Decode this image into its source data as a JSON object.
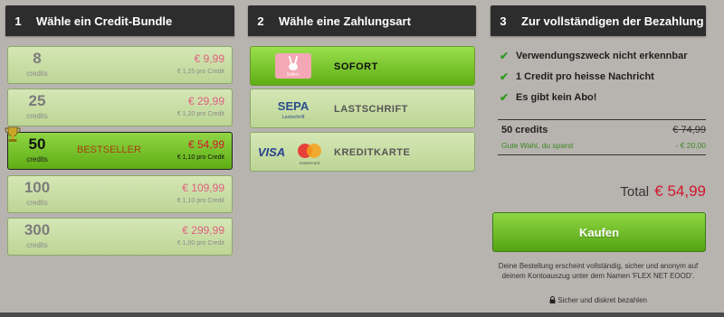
{
  "steps": [
    {
      "num": "1",
      "title": "Wähle ein Credit-Bundle"
    },
    {
      "num": "2",
      "title": "Wähle eine Zahlungsart"
    },
    {
      "num": "3",
      "title": "Zur vollständigen der Bezahlung"
    }
  ],
  "bundles": [
    {
      "credits": "8",
      "label": "credits",
      "price": "€ 9,99",
      "per": "€ 1,25 pro Credit"
    },
    {
      "credits": "25",
      "label": "credits",
      "price": "€ 29,99",
      "per": "€ 1,20 pro Credit"
    },
    {
      "credits": "50",
      "label": "credits",
      "price": "€ 54,99",
      "per": "€ 1,10 pro Credit",
      "badge": "BESTSELLER",
      "selected": true
    },
    {
      "credits": "100",
      "label": "credits",
      "price": "€ 109,99",
      "per": "€ 1,10 pro Credit"
    },
    {
      "credits": "300",
      "label": "credits",
      "price": "€ 299,99",
      "per": "€ 1,00 pro Credit"
    }
  ],
  "payments": [
    {
      "label": "SOFORT",
      "logo_text": "Sofort.",
      "icon": "sofort-logo-icon",
      "selected": true
    },
    {
      "label": "LASTSCHRIFT",
      "logo_text": "SEPA",
      "logo_sub": "Lastschrift",
      "icon": "sepa-logo-icon"
    },
    {
      "label": "KREDITKARTE",
      "logo_text": "VISA",
      "logo_sub": "mastercard",
      "icon": "visa-mastercard-logo-icon"
    }
  ],
  "benefits": [
    "Verwendungszweck nicht erkennbar",
    "1 Credit pro heisse Nachricht",
    "Es gibt kein Abo!"
  ],
  "summary": {
    "item": "50 credits",
    "old_price": "€ 74,99",
    "saving_text": "Gute Wahl, du sparst",
    "saving": "- € 20,00"
  },
  "total": {
    "label": "Total",
    "amount": "€ 54,99"
  },
  "buy_label": "Kaufen",
  "note": "Deine Bestellung erscheint vollständig, sicher und anonym auf deinem Kontoauszug unter dem Namen 'FLEX NET EOOD'.",
  "secure_text": "Sicher und diskret bezahlen",
  "colors": {
    "accent_green": "#6cc023",
    "price_red": "#d0182e",
    "header_dark": "#2d2d2d",
    "background": "#b7b3af"
  }
}
